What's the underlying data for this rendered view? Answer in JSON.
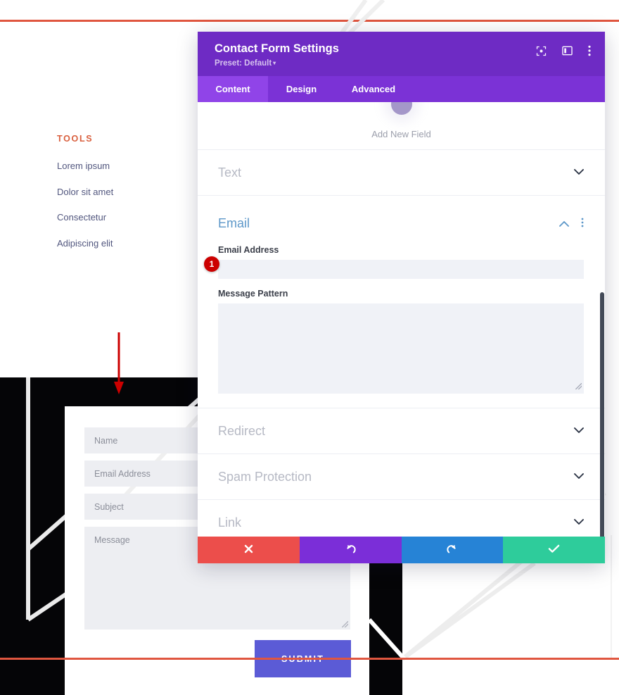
{
  "page": {
    "background": {
      "tools_heading": "TOOLS",
      "tools_links": [
        "Lorem ipsum",
        "Dolor sit amet",
        "Consectetur",
        "Adipiscing elit"
      ],
      "frontend_form": {
        "name_placeholder": "Name",
        "email_placeholder": "Email Address",
        "subject_placeholder": "Subject",
        "message_placeholder": "Message",
        "submit_label": "SUBMIT"
      },
      "accent_rule_color": "#e0563f",
      "submit_color": "#5b5bd6",
      "hero_color": "#050507"
    },
    "annotation": {
      "marker_number": "1",
      "marker_color": "#cc0000",
      "arrow_color": "#cc0000"
    }
  },
  "modal": {
    "title": "Contact Form Settings",
    "preset_label": "Preset: Default",
    "preset_caret": "▾",
    "header_color": "#6e2bc4",
    "tabbar_color": "#7b32d6",
    "active_tab_color": "#9044e8",
    "header_icons": [
      {
        "name": "focus-icon",
        "title": "Focus"
      },
      {
        "name": "layout-panel-icon",
        "title": "Layout"
      },
      {
        "name": "more-options-icon",
        "title": "More options"
      }
    ],
    "tabs": [
      {
        "label": "Content",
        "active": true
      },
      {
        "label": "Design",
        "active": false
      },
      {
        "label": "Advanced",
        "active": false
      }
    ],
    "add_new_field": {
      "label": "Add New Field"
    },
    "sections": [
      {
        "label": "Text",
        "state": "collapsed"
      },
      {
        "label": "Email",
        "state": "expanded"
      },
      {
        "label": "Redirect",
        "state": "collapsed"
      },
      {
        "label": "Spam Protection",
        "state": "collapsed"
      },
      {
        "label": "Link",
        "state": "collapsed"
      }
    ],
    "email_panel": {
      "email_address_label": "Email Address",
      "email_address_value": "",
      "email_address_placeholder": "",
      "message_pattern_label": "Message Pattern",
      "message_pattern_value": "",
      "message_pattern_placeholder": ""
    },
    "footer_buttons": [
      {
        "name": "close-button",
        "icon": "x-icon",
        "color": "#ec4e4b"
      },
      {
        "name": "undo-button",
        "icon": "undo-icon",
        "color": "#7b2ed8"
      },
      {
        "name": "redo-button",
        "icon": "redo-icon",
        "color": "#2683d6"
      },
      {
        "name": "save-button",
        "icon": "check-icon",
        "color": "#2ecc9b"
      }
    ]
  }
}
